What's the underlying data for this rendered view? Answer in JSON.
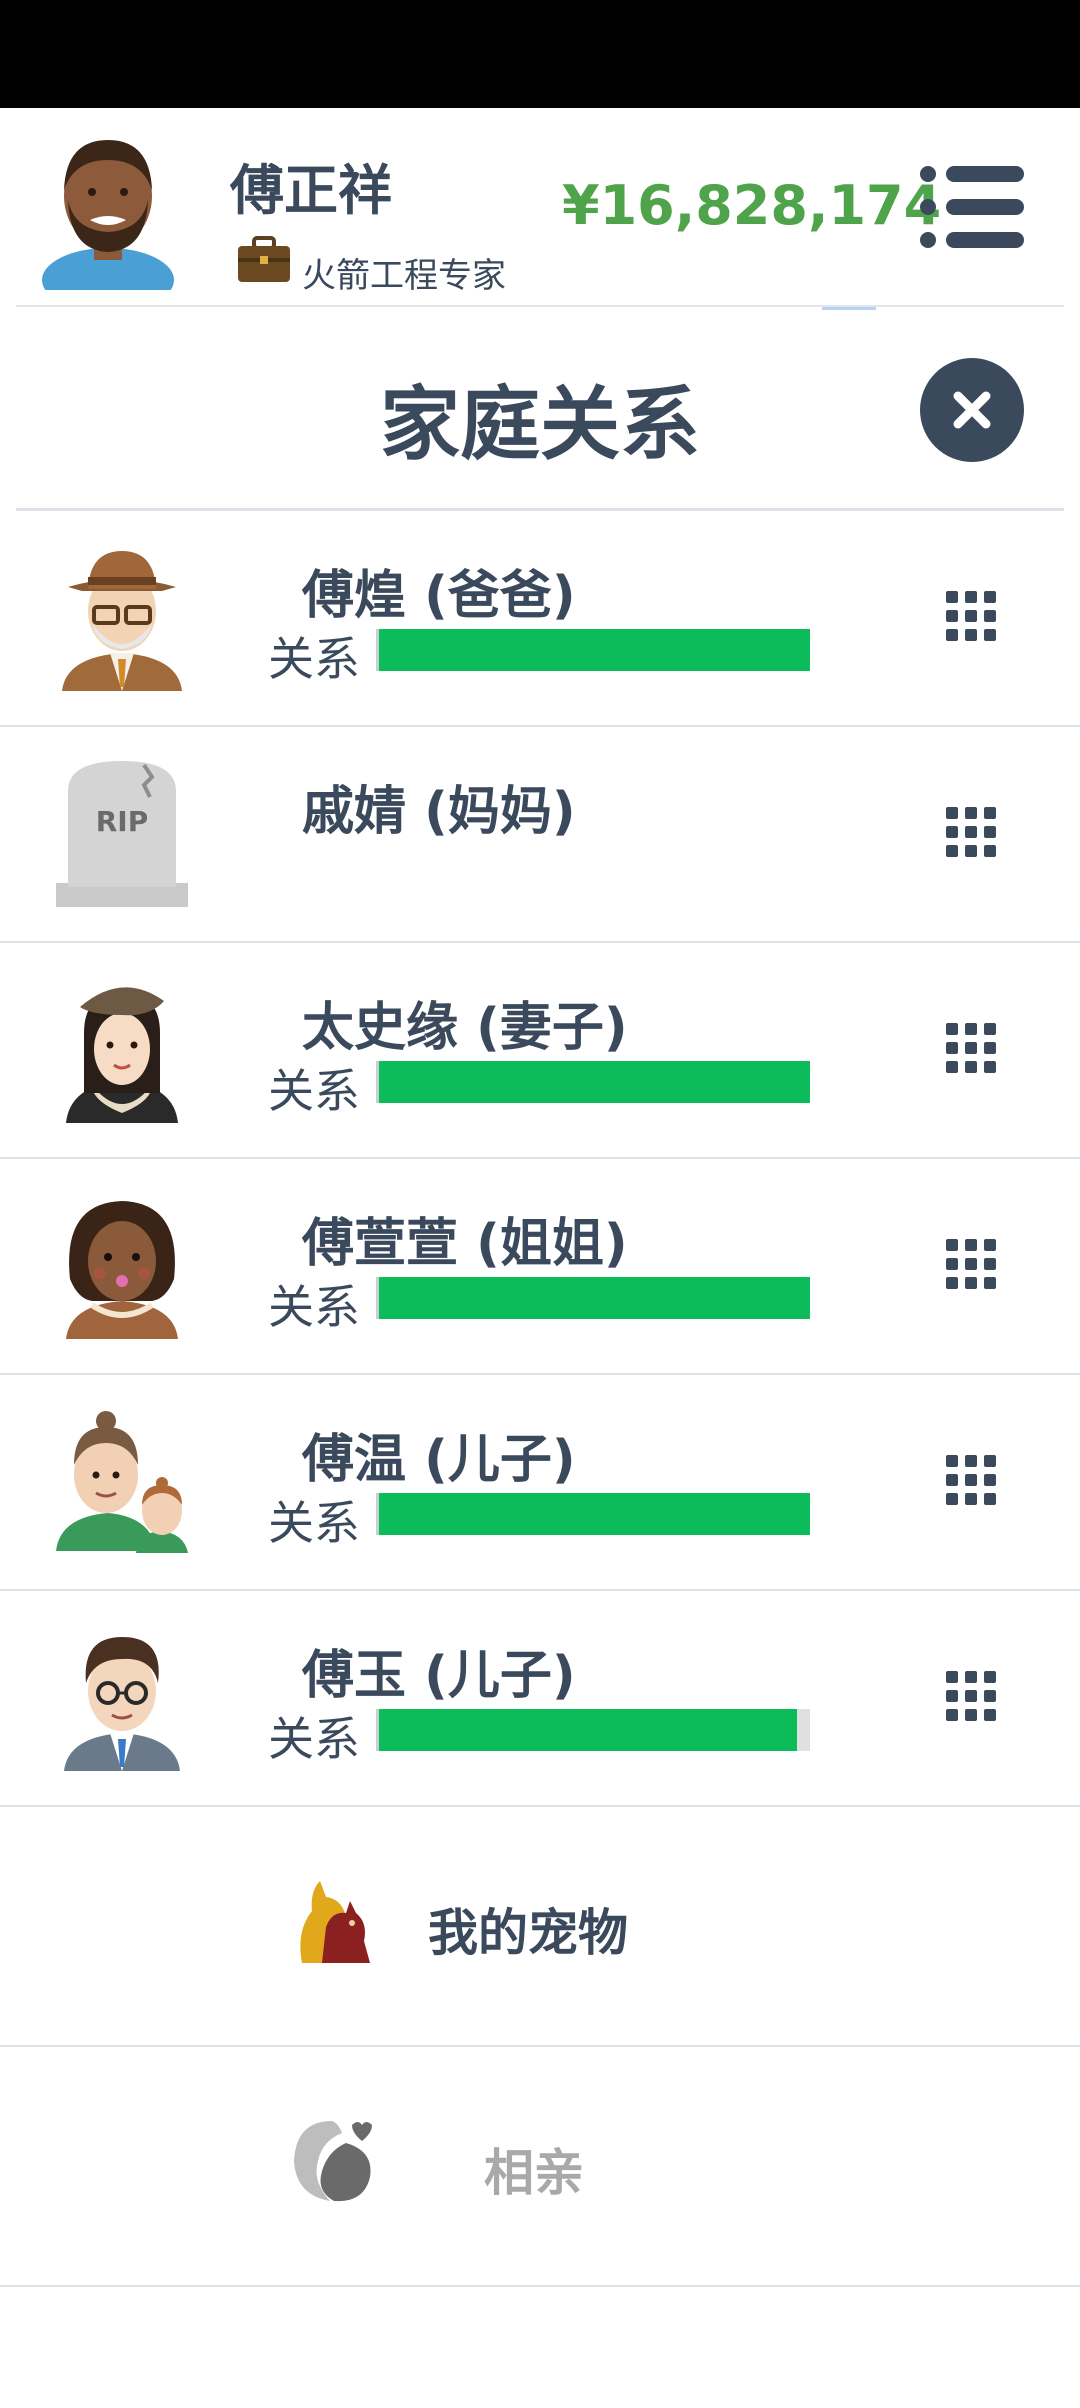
{
  "header": {
    "player_name": "傅正祥",
    "job": "火箭工程专家",
    "money": "¥16,828,174"
  },
  "dialog": {
    "title": "家庭关系"
  },
  "relationship_label": "关系",
  "family": [
    {
      "name": "傅煌 (爸爸)",
      "relationship": 1.0,
      "deceased": false
    },
    {
      "name": "戚婧 (妈妈)",
      "relationship": null,
      "deceased": true
    },
    {
      "name": "太史缘 (妻子)",
      "relationship": 1.0,
      "deceased": false
    },
    {
      "name": "傅萱萱 (姐姐)",
      "relationship": 1.0,
      "deceased": false
    },
    {
      "name": "傅温 (儿子)",
      "relationship": 1.0,
      "deceased": false
    },
    {
      "name": "傅玉 (儿子)",
      "relationship": 0.97,
      "deceased": false
    }
  ],
  "menu": {
    "pets_label": "我的宠物",
    "dating_label": "相亲"
  },
  "colors": {
    "bar_fill": "#0cbc5a",
    "money": "#4fa34a",
    "text": "#3a4a5c"
  },
  "icons": {
    "tombstone_text": "RIP"
  }
}
